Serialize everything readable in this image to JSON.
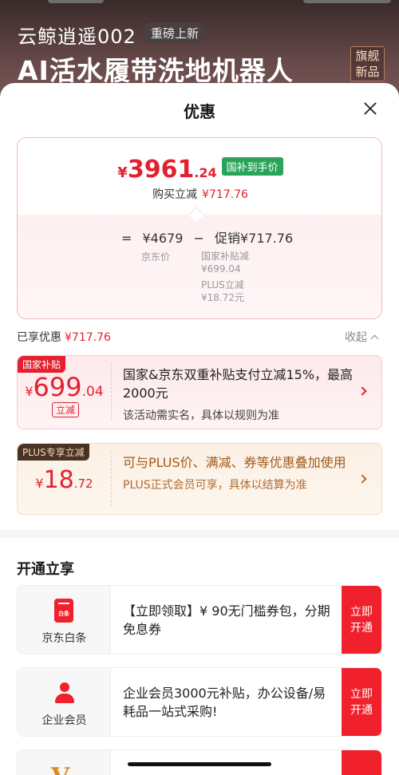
{
  "background": {
    "brand": "云鲸逍遥002",
    "badge": "重磅上新",
    "title": "AI活水履带洗地机器人",
    "flag_line1": "旗舰",
    "flag_line2": "新品"
  },
  "sheet": {
    "title": "优惠",
    "close_icon": "close-icon"
  },
  "price_card": {
    "yen": "¥",
    "price_int": "3961",
    "price_dec": ".24",
    "price_tag": "国补到手价",
    "buy_label": "购买立减",
    "buy_amount": "¥717.76",
    "formula": {
      "eq": "=",
      "jd_price": "¥4679",
      "minus": "−",
      "promo": "促销¥717.76"
    },
    "jd_price_label": "京东价",
    "sub_items": [
      {
        "label": "国家补贴减",
        "value": "¥699.04"
      },
      {
        "label": "PLUS立减",
        "value": "¥18.72元"
      }
    ]
  },
  "enjoyed": {
    "label": "已享优惠",
    "amount": "¥717.76",
    "collapse": "收起"
  },
  "coupons": [
    {
      "label": "国家补贴",
      "yen": "¥",
      "int": "699",
      "dec": ".04",
      "tag": "立减",
      "main": "国家&京东双重补贴支付立减15%，最高2000元",
      "sub": "该活动需实名，具体以规则为准"
    },
    {
      "label": "PLUS专享立减",
      "yen": "¥",
      "int": "18",
      "dec": ".72",
      "main": "可与PLUS价、满减、券等优惠叠加使用",
      "sub": "PLUS正式会员可享，具体以结算为准"
    }
  ],
  "open_section": {
    "title": "开通立享",
    "cards": [
      {
        "icon": "baitiao-icon",
        "icon_text": "白条",
        "name": "京东白条",
        "desc": "【立即领取】¥ 90无门槛券包，分期免息券",
        "btn1": "立即",
        "btn2": "开通"
      },
      {
        "icon": "enterprise-member-icon",
        "name": "企业会员",
        "desc": "企业会员3000元补贴，办公设备/易耗品一站式采购!",
        "btn1": "立即",
        "btn2": "开通"
      },
      {
        "icon": "plus-member-icon",
        "icon_text": "V",
        "btn1": "",
        "btn2": ""
      }
    ]
  },
  "colors": {
    "accent_red": "#e4202f",
    "green_tag": "#2aa45a",
    "plus_brown": "#4a3326"
  }
}
